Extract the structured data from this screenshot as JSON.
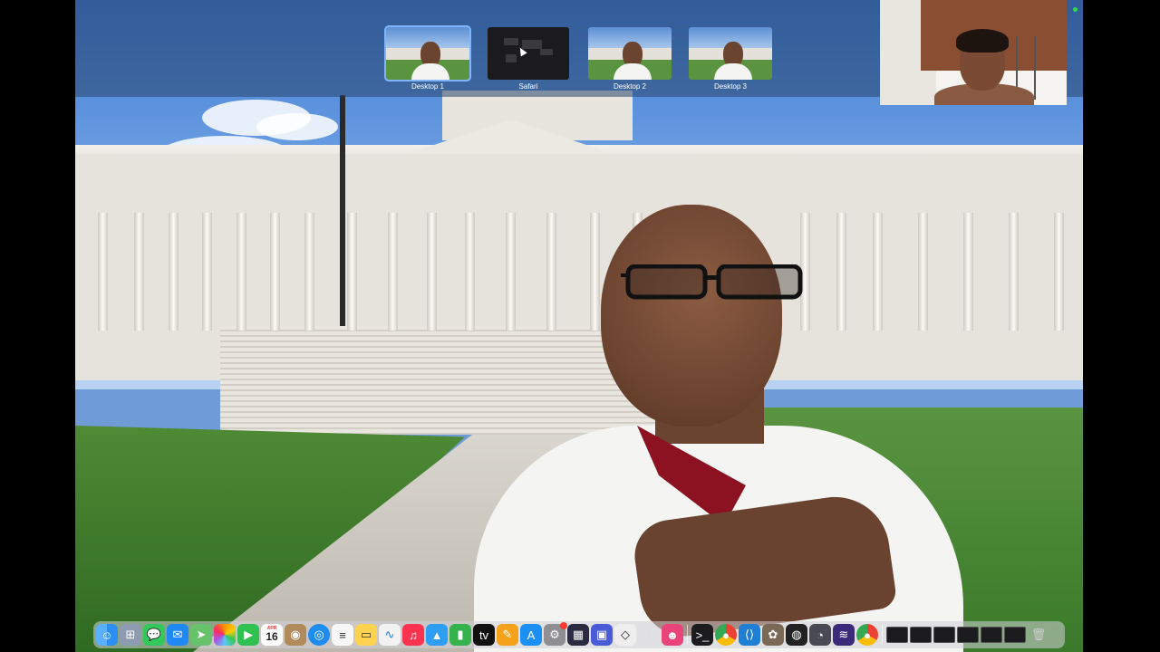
{
  "mission_control": {
    "spaces": [
      {
        "label": "Desktop 1",
        "active": true
      },
      {
        "label": "Safari",
        "active": false
      },
      {
        "label": "Desktop 2",
        "active": false
      },
      {
        "label": "Desktop 3",
        "active": false
      }
    ]
  },
  "dock": {
    "calendar": {
      "month": "APR",
      "day": "16"
    },
    "apps": [
      "finder-icon",
      "launchpad-icon",
      "messages-icon",
      "mail-icon",
      "maps-icon",
      "photos-icon",
      "facetime-icon",
      "calendar-icon",
      "contacts-icon",
      "safari-icon",
      "reminders-icon",
      "notes-icon",
      "freeform-icon",
      "music-icon",
      "keynote-icon",
      "numbers-icon",
      "tv-icon",
      "pages-icon",
      "app-store-icon",
      "system-settings-icon",
      "mission-control-icon",
      "screen-sharing-icon",
      "unity-icon",
      "help-icon",
      "bot-icon",
      "terminal-icon",
      "chrome-icon",
      "vscode-icon",
      "gimp-icon",
      "obs-icon",
      "disk-utility-icon",
      "audio-icon",
      "chrome-canary-icon"
    ]
  },
  "colors": {
    "accent": "#7fb4ff",
    "tie": "#8c1222",
    "badge": "#ff3b30"
  }
}
